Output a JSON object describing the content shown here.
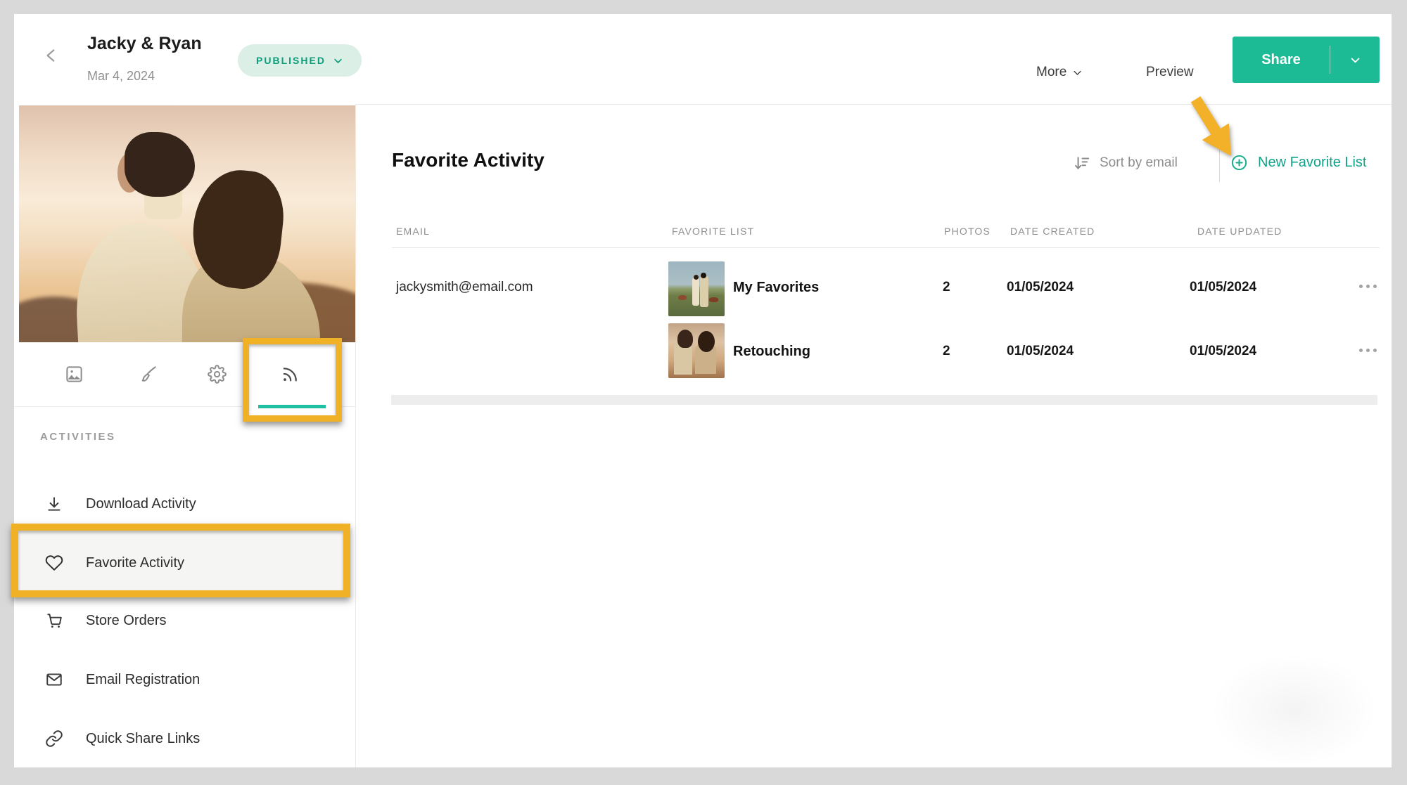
{
  "header": {
    "title": "Jacky & Ryan",
    "date": "Mar 4, 2024",
    "status_badge": {
      "label": "PUBLISHED",
      "text_color": "#0b9e7a",
      "bg_color": "#dcefe7"
    },
    "more_label": "More",
    "preview_label": "Preview",
    "share_label": "Share",
    "share_color": "#1cba95"
  },
  "sidebar": {
    "tabs": [
      {
        "name": "photos",
        "icon": "image-icon",
        "active": false
      },
      {
        "name": "design",
        "icon": "brush-icon",
        "active": false
      },
      {
        "name": "settings",
        "icon": "gear-icon",
        "active": false
      },
      {
        "name": "activity",
        "icon": "rss-icon",
        "active": true,
        "annotated": true
      }
    ],
    "active_tab_underline_color": "#1dc0a0",
    "section_label": "ACTIVITIES",
    "items": [
      {
        "label": "Download Activity",
        "icon": "download-icon",
        "active": false
      },
      {
        "label": "Favorite Activity",
        "icon": "heart-icon",
        "active": true,
        "annotated": true
      },
      {
        "label": "Store Orders",
        "icon": "cart-icon",
        "active": false
      },
      {
        "label": "Email Registration",
        "icon": "envelope-icon",
        "active": false
      },
      {
        "label": "Quick Share Links",
        "icon": "link-icon",
        "active": false
      }
    ]
  },
  "main": {
    "title": "Favorite Activity",
    "toolbar": {
      "sort_label": "Sort by email",
      "sort_icon": "sort-descending-icon",
      "new_list_label": "New Favorite List",
      "new_list_icon": "plus-circle-icon",
      "link_color": "#12a287"
    },
    "table": {
      "columns": [
        "EMAIL",
        "FAVORITE LIST",
        "PHOTOS",
        "DATE CREATED",
        "DATE UPDATED"
      ],
      "rows": [
        {
          "email": "jackysmith@email.com",
          "list_name": "My Favorites",
          "photos": "2",
          "date_created": "01/05/2024",
          "date_updated": "01/05/2024",
          "thumb": "couple-standing-in-field",
          "actions_icon": "ellipsis-icon"
        },
        {
          "email": "",
          "list_name": "Retouching",
          "photos": "2",
          "date_created": "01/05/2024",
          "date_updated": "01/05/2024",
          "thumb": "couple-at-sunset",
          "actions_icon": "ellipsis-icon"
        }
      ]
    }
  },
  "annotations": {
    "highlight_color": "#f1b126",
    "boxes": [
      "activity-tab",
      "favorite-activity-item"
    ],
    "arrow_target": "New Favorite List"
  }
}
